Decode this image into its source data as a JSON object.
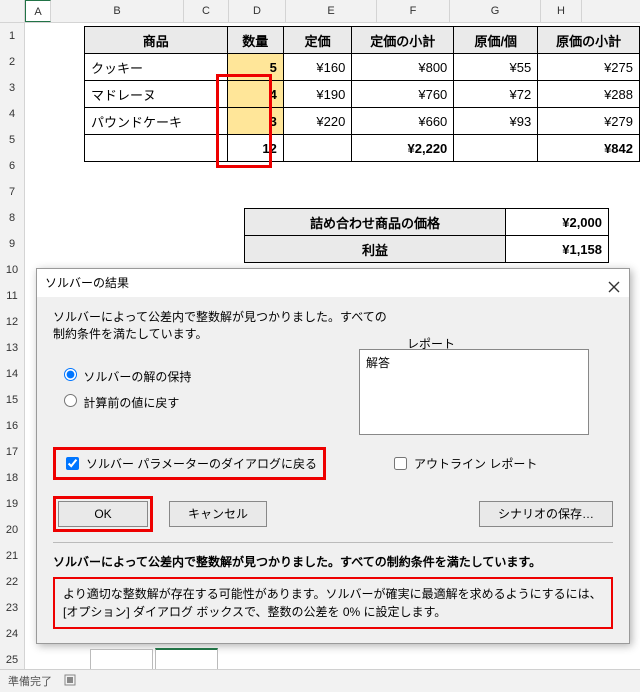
{
  "columns": [
    "A",
    "B",
    "C",
    "D",
    "E",
    "F",
    "G",
    "H"
  ],
  "rows": [
    "1",
    "2",
    "3",
    "4",
    "5",
    "6",
    "7",
    "8",
    "9",
    "10",
    "11",
    "12",
    "13",
    "14",
    "15",
    "16",
    "17",
    "18",
    "19",
    "20",
    "21",
    "22",
    "23",
    "24",
    "25"
  ],
  "table": {
    "headers": {
      "b": "商品",
      "c": "数量",
      "d": "定価",
      "e": "定価の小計",
      "f": "原価/個",
      "g": "原価の小計"
    },
    "rows": [
      {
        "b": "クッキー",
        "c": "5",
        "d": "¥160",
        "e": "¥800",
        "f": "¥55",
        "g": "¥275"
      },
      {
        "b": "マドレーヌ",
        "c": "4",
        "d": "¥190",
        "e": "¥760",
        "f": "¥72",
        "g": "¥288"
      },
      {
        "b": "パウンドケーキ",
        "c": "3",
        "d": "¥220",
        "e": "¥660",
        "f": "¥93",
        "g": "¥279"
      }
    ],
    "totals": {
      "c": "12",
      "e": "¥2,220",
      "g": "¥842"
    }
  },
  "sub": {
    "r1": {
      "label": "詰め合わせ商品の価格",
      "val": "¥2,000"
    },
    "r2": {
      "label": "利益",
      "val": "¥1,158"
    }
  },
  "dlg": {
    "title": "ソルバーの結果",
    "msg1": "ソルバーによって公差内で整数解が見つかりました。すべての",
    "msg2": "制約条件を満たしています。",
    "reportLabel": "レポート",
    "reportItem": "解答",
    "opt1": "ソルバーの解の保持",
    "opt2": "計算前の値に戻す",
    "chk1": "ソルバー パラメーターのダイアログに戻る",
    "chk2": "アウトライン レポート",
    "ok": "OK",
    "cancel": "キャンセル",
    "save": "シナリオの保存…",
    "bold": "ソルバーによって公差内で整数解が見つかりました。すべての制約条件を満たしています。",
    "note": "より適切な整数解が存在する可能性があります。ソルバーが確実に最適解を求めるようにするには、[オプション] ダイアログ ボックスで、整数の公差を 0% に設定します。"
  },
  "status": {
    "ready": "準備完了"
  },
  "chart_data": {
    "type": "table",
    "columns": [
      "商品",
      "数量",
      "定価",
      "定価の小計",
      "原価/個",
      "原価の小計"
    ],
    "rows": [
      [
        "クッキー",
        5,
        160,
        800,
        55,
        275
      ],
      [
        "マドレーヌ",
        4,
        190,
        760,
        72,
        288
      ],
      [
        "パウンドケーキ",
        3,
        220,
        660,
        93,
        279
      ]
    ],
    "totals": {
      "数量": 12,
      "定価の小計": 2220,
      "原価の小計": 842
    },
    "summary": {
      "詰め合わせ商品の価格": 2000,
      "利益": 1158
    }
  }
}
